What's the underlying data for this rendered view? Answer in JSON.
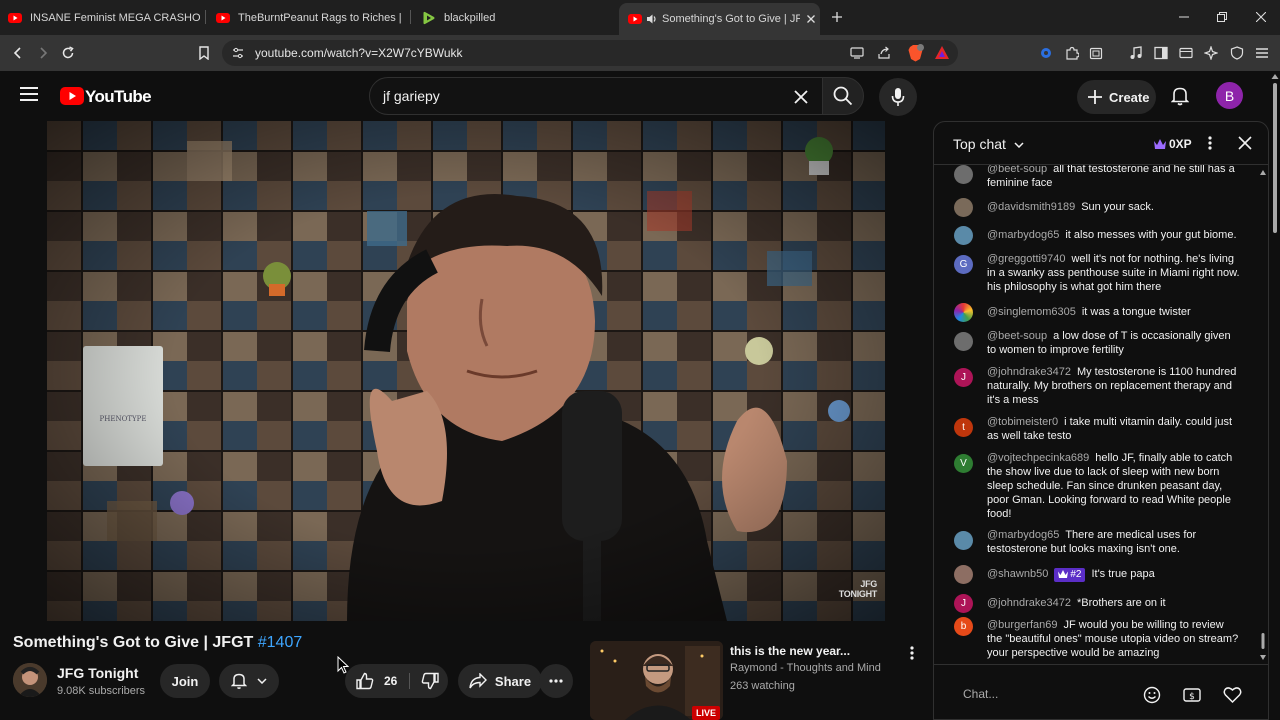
{
  "browser": {
    "tabs": [
      {
        "label": "INSANE Feminist MEGA CRASHOUT"
      },
      {
        "label": "TheBurntPeanut Rags to Riches | ARC"
      },
      {
        "label": "blackpilled"
      },
      {
        "label": "Something's Got to Give | JFG"
      }
    ],
    "url": "youtube.com/watch?v=X2W7cYBWukk"
  },
  "youtube": {
    "logo": "YouTube",
    "search_value": "jf gariepy",
    "create_label": "Create",
    "user_initial": "B"
  },
  "video": {
    "watermark_line1": "JFG",
    "watermark_line2": "TONIGHT",
    "title": "Something's Got to Give | JFGT ",
    "title_tag": "#1407",
    "channel_name": "JFG Tonight",
    "subscribers": "9.08K subscribers",
    "join_label": "Join",
    "likes": "26",
    "share_label": "Share"
  },
  "recommendation": {
    "title": "this is the new year...",
    "channel": "Raymond - Thoughts and Mind",
    "watching": "263 watching",
    "badge": "LIVE"
  },
  "chat": {
    "title": "Top chat",
    "xp_label": "0XP",
    "input_placeholder": "Chat...",
    "messages": [
      {
        "author": "@beet-soup",
        "text": "all that testosterone and he still has a feminine face",
        "avatar_color": "#6d6d6d",
        "initial": ""
      },
      {
        "author": "@davidsmith9189",
        "text": "Sun your sack.",
        "avatar_color": "#7a6a5a",
        "initial": ""
      },
      {
        "author": "@marbydog65",
        "text": "it also messes with your gut biome.",
        "avatar_color": "#5a8aa8",
        "initial": ""
      },
      {
        "author": "@greggotti9740",
        "text": "well it's not for nothing. he's living in a swanky ass penthouse suite in Miami right now. his philosophy is what got him there",
        "avatar_color": "#5c6bc0",
        "initial": "G"
      },
      {
        "author": "@singlemom6305",
        "text": "it was a tongue twister",
        "avatar_color": "#43a047",
        "initial": ""
      },
      {
        "author": "@beet-soup",
        "text": "a low dose of T is occasionally given to women to improve fertility",
        "avatar_color": "#6d6d6d",
        "initial": ""
      },
      {
        "author": "@johndrake3472",
        "text": "My testosterone is 1100 hundred naturally. My brothers on replacement therapy and it's a mess",
        "avatar_color": "#ad1457",
        "initial": "J"
      },
      {
        "author": "@tobimeister0",
        "text": "i take multi vitamin daily. could just as well take testo",
        "avatar_color": "#bf360c",
        "initial": "t"
      },
      {
        "author": "@vojtechpecinka689",
        "text": "hello JF, finally able to catch the show live due to lack of sleep with new born sleep schedule. Fan since drunken peasant day, poor Gman. Looking forward to read White people food!",
        "avatar_color": "#2e7d32",
        "initial": "V"
      },
      {
        "author": "@marbydog65",
        "text": "There are medical uses for testosterone but looks maxing isn't one.",
        "avatar_color": "#5a8aa8",
        "initial": ""
      },
      {
        "author": "@shawnb50",
        "text": "It's true papa",
        "avatar_color": "#8d6e63",
        "initial": "",
        "rank": "#2"
      },
      {
        "author": "@johndrake3472",
        "text": "*Brothers are on it",
        "avatar_color": "#ad1457",
        "initial": "J"
      },
      {
        "author": "@burgerfan69",
        "text": "JF would you be willing to review the \"beautiful ones\" mouse utopia video on stream? your perspective would be amazing",
        "avatar_color": "#e64a19",
        "initial": "b"
      }
    ]
  },
  "colors": {
    "yt_red": "#ff0000",
    "link_blue": "#3ea6ff",
    "live_red": "#cc0000"
  }
}
